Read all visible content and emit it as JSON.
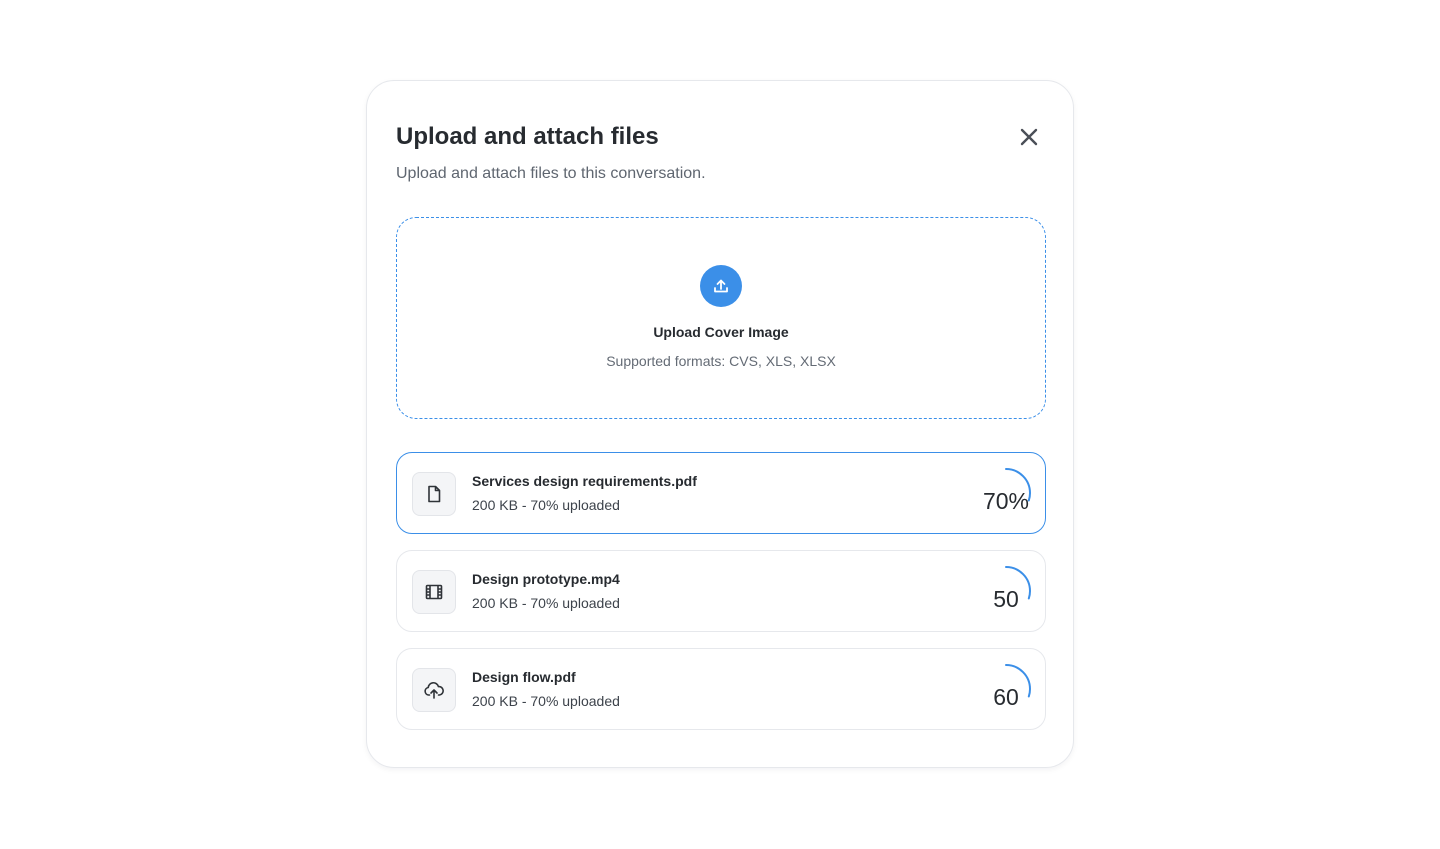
{
  "modal": {
    "title": "Upload and attach files",
    "subtitle": "Upload and attach files to this conversation.",
    "close_icon": "close-icon"
  },
  "dropzone": {
    "icon": "upload-icon",
    "title": "Upload Cover Image",
    "formats": "Supported formats: CVS, XLS, XLSX"
  },
  "files": [
    {
      "name": "Services design requirements.pdf",
      "meta": "200 KB - 70% uploaded",
      "icon": "document-icon",
      "progress_label": "70%",
      "progress": 0.3,
      "active": true
    },
    {
      "name": "Design prototype.mp4",
      "meta": "200 KB - 70% uploaded",
      "icon": "film-icon",
      "progress_label": "50",
      "progress": 0.3,
      "active": false
    },
    {
      "name": "Design flow.pdf",
      "meta": "200 KB - 70% uploaded",
      "icon": "cloud-upload-icon",
      "progress_label": "60",
      "progress": 0.3,
      "active": false
    }
  ],
  "colors": {
    "accent": "#3b8fe8",
    "border": "#e6e8ec",
    "text": "#272b30",
    "muted": "#5f6670"
  }
}
